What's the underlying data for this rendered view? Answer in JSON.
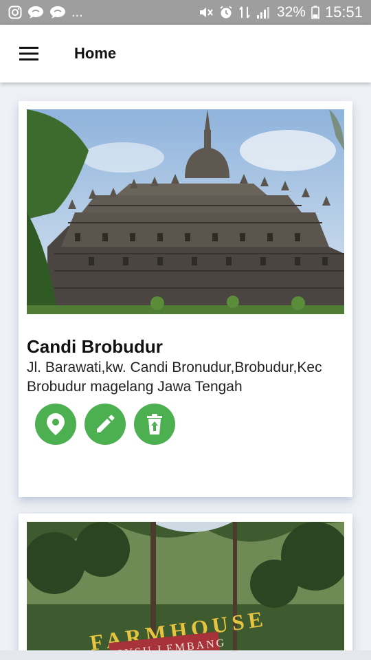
{
  "status_bar": {
    "left_icons": [
      "instagram-icon",
      "chat-bubble-icon",
      "chat-bubble-icon"
    ],
    "overflow": "...",
    "right_icons": [
      "mute-icon",
      "alarm-icon",
      "data-icon",
      "signal-icon"
    ],
    "battery_percent": "32%",
    "time": "15:51"
  },
  "app_bar": {
    "menu_icon": "hamburger-icon",
    "title": "Home"
  },
  "places": [
    {
      "name": "Candi Brobudur",
      "address": "Jl. Barawati,kw. Candi Bronudur,Brobudur,Kec Brobudur magelang Jawa Tengah",
      "actions": [
        "location-icon",
        "edit-icon",
        "delete-icon"
      ]
    },
    {
      "sign_text": "FARMHOUSE",
      "sub_sign_text": "SUSU LEMBANG"
    }
  ],
  "colors": {
    "accent": "#4caf50",
    "status_bar": "#9e9e9e",
    "background": "#eef1f5"
  }
}
